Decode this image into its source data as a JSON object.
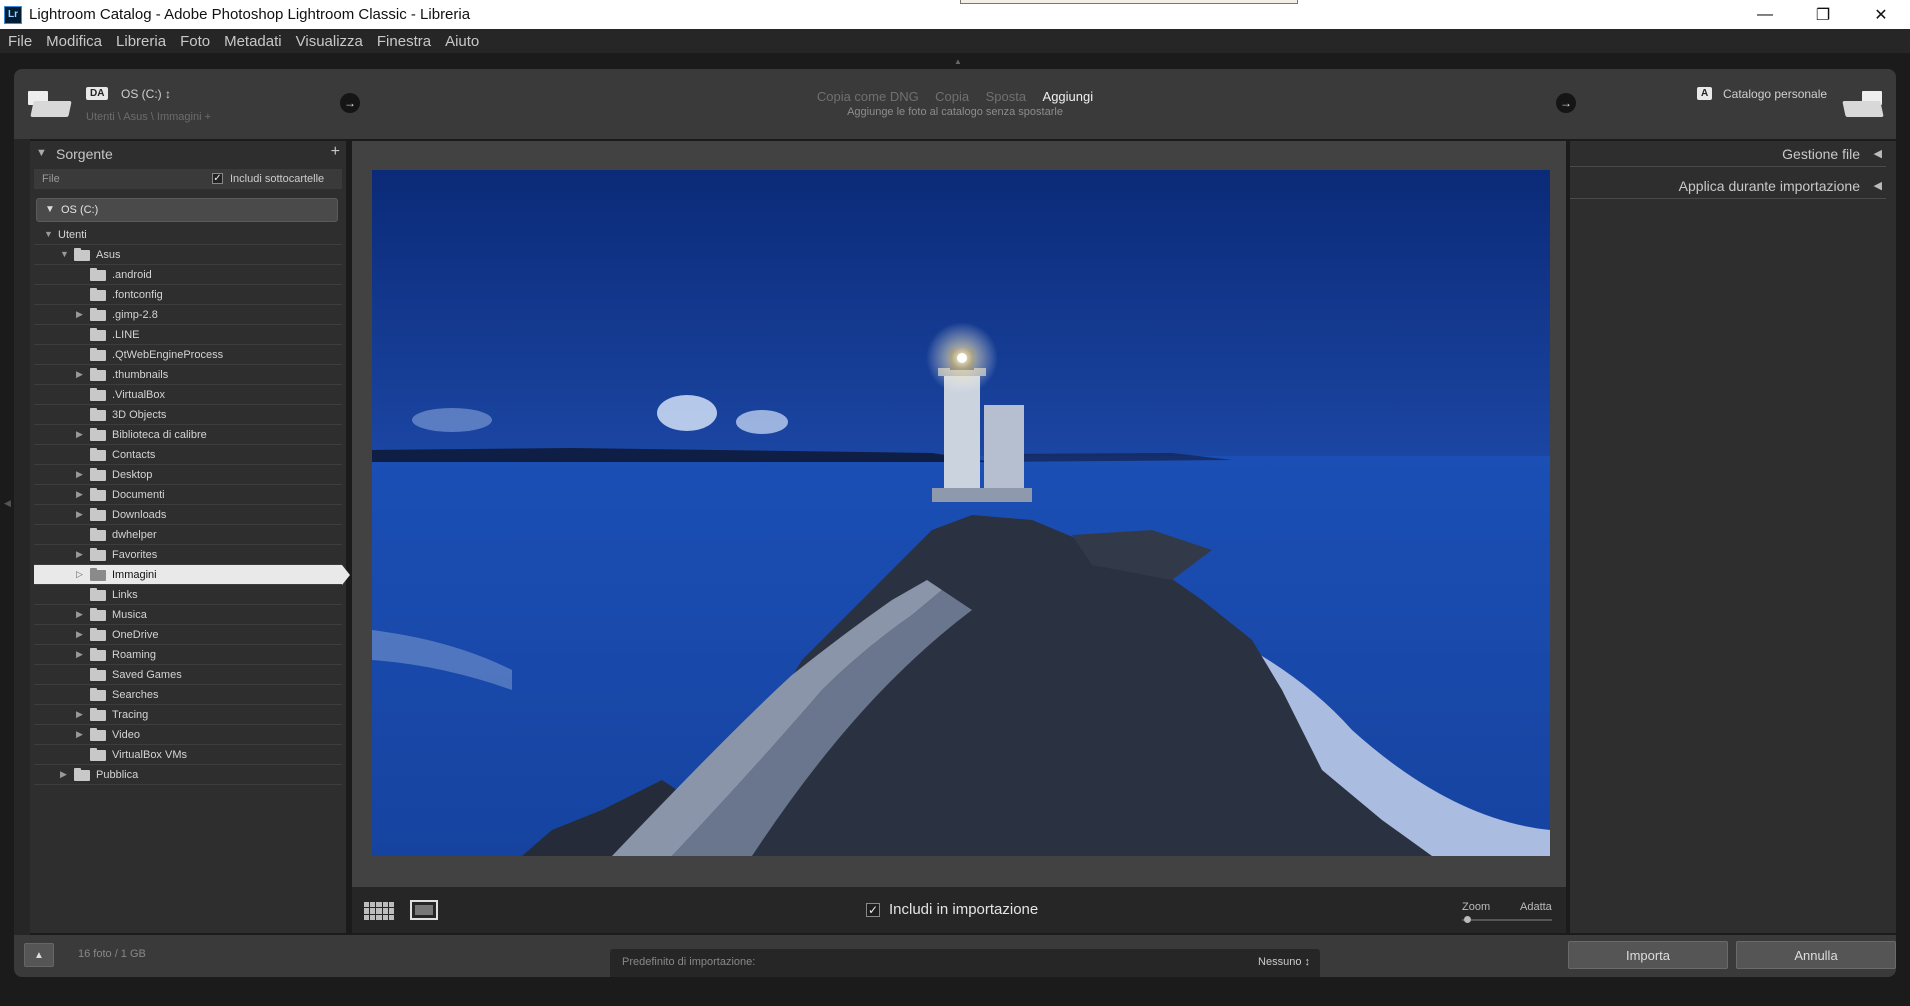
{
  "window": {
    "title": "Lightroom Catalog - Adobe Photoshop Lightroom Classic - Libreria",
    "app_icon_text": "Lr",
    "minimize": "—",
    "maximize": "❐",
    "close": "✕"
  },
  "menu": [
    "File",
    "Modifica",
    "Libreria",
    "Foto",
    "Metadati",
    "Visualizza",
    "Finestra",
    "Aiuto"
  ],
  "header": {
    "source_badge": "DA",
    "source_drive": "OS (C:) ↕",
    "source_path": "Utenti \\ Asus \\ Immagini +",
    "modes": [
      "Copia come DNG",
      "Copia",
      "Sposta",
      "Aggiungi"
    ],
    "active_mode": "Aggiungi",
    "mode_description": "Aggiunge le foto al catalogo senza spostarle",
    "dest_badge": "A",
    "catalog_name": "Catalogo personale",
    "arrow": "→"
  },
  "source_panel": {
    "title": "Sorgente",
    "add": "+",
    "file_label": "File",
    "include_subfolders": "Includi sottocartelle",
    "drive": "OS (C:)",
    "tree": [
      {
        "label": "Utenti",
        "depth": 0,
        "expander": "down",
        "folder": false
      },
      {
        "label": "Asus",
        "depth": 1,
        "expander": "down",
        "folder": true
      },
      {
        "label": ".android",
        "depth": 2,
        "expander": "none",
        "folder": true
      },
      {
        "label": ".fontconfig",
        "depth": 2,
        "expander": "none",
        "folder": true
      },
      {
        "label": ".gimp-2.8",
        "depth": 2,
        "expander": "right",
        "folder": true
      },
      {
        "label": ".LINE",
        "depth": 2,
        "expander": "none",
        "folder": true
      },
      {
        "label": ".QtWebEngineProcess",
        "depth": 2,
        "expander": "none",
        "folder": true
      },
      {
        "label": ".thumbnails",
        "depth": 2,
        "expander": "right",
        "folder": true
      },
      {
        "label": ".VirtualBox",
        "depth": 2,
        "expander": "none",
        "folder": true
      },
      {
        "label": "3D Objects",
        "depth": 2,
        "expander": "none",
        "folder": true
      },
      {
        "label": "Biblioteca di calibre",
        "depth": 2,
        "expander": "right",
        "folder": true
      },
      {
        "label": "Contacts",
        "depth": 2,
        "expander": "none",
        "folder": true
      },
      {
        "label": "Desktop",
        "depth": 2,
        "expander": "right",
        "folder": true
      },
      {
        "label": "Documenti",
        "depth": 2,
        "expander": "right",
        "folder": true
      },
      {
        "label": "Downloads",
        "depth": 2,
        "expander": "right",
        "folder": true
      },
      {
        "label": "dwhelper",
        "depth": 2,
        "expander": "none",
        "folder": true
      },
      {
        "label": "Favorites",
        "depth": 2,
        "expander": "right",
        "folder": true
      },
      {
        "label": "Immagini",
        "depth": 2,
        "expander": "right-outline",
        "folder": true,
        "selected": true
      },
      {
        "label": "Links",
        "depth": 2,
        "expander": "none",
        "folder": true
      },
      {
        "label": "Musica",
        "depth": 2,
        "expander": "right",
        "folder": true
      },
      {
        "label": "OneDrive",
        "depth": 2,
        "expander": "right",
        "folder": true
      },
      {
        "label": "Roaming",
        "depth": 2,
        "expander": "right",
        "folder": true
      },
      {
        "label": "Saved Games",
        "depth": 2,
        "expander": "none",
        "folder": true
      },
      {
        "label": "Searches",
        "depth": 2,
        "expander": "none",
        "folder": true
      },
      {
        "label": "Tracing",
        "depth": 2,
        "expander": "right",
        "folder": true
      },
      {
        "label": "Video",
        "depth": 2,
        "expander": "right",
        "folder": true
      },
      {
        "label": "VirtualBox VMs",
        "depth": 2,
        "expander": "none",
        "folder": true
      },
      {
        "label": "Pubblica",
        "depth": 1,
        "expander": "right",
        "folder": true
      }
    ]
  },
  "preview": {
    "include_in_import": "Includi in importazione",
    "zoom_label": "Zoom",
    "fit_label": "Adatta"
  },
  "right_panel": {
    "sections": [
      "Gestione file",
      "Applica durante importazione"
    ]
  },
  "bottom": {
    "photo_count": "16 foto / 1 GB",
    "preset_label": "Predefinito di importazione:",
    "preset_value": "Nessuno ↕",
    "import_button": "Importa",
    "cancel_button": "Annulla"
  }
}
